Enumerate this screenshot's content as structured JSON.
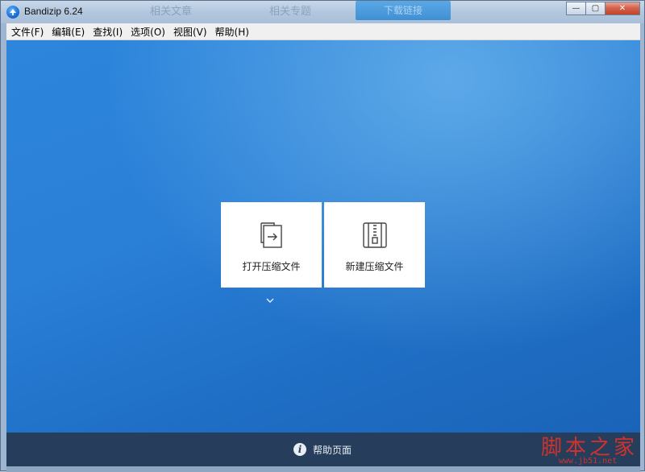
{
  "window": {
    "title": "Bandizip 6.24",
    "controls": {
      "minimize": "—",
      "maximize": "▢",
      "close": "✕"
    }
  },
  "background_ghosts": [
    "相关文章",
    "相关专题",
    "下载链接"
  ],
  "menubar": {
    "items": [
      "文件(F)",
      "编辑(E)",
      "查找(I)",
      "选项(O)",
      "视图(V)",
      "帮助(H)"
    ]
  },
  "main": {
    "open_archive": {
      "label": "打开压缩文件",
      "icon": "open-archive-icon"
    },
    "new_archive": {
      "label": "新建压缩文件",
      "icon": "new-archive-zip-icon"
    },
    "more": {
      "icon": "chevron-down-icon"
    }
  },
  "footer": {
    "help_label": "帮助页面",
    "help_icon": "info-icon"
  },
  "watermark": {
    "brand": "脚本之家",
    "url": "www.jb51.net"
  },
  "colors": {
    "accent": "#2a7fd6",
    "footer": "#263e5c",
    "watermark": "#d0312d"
  }
}
